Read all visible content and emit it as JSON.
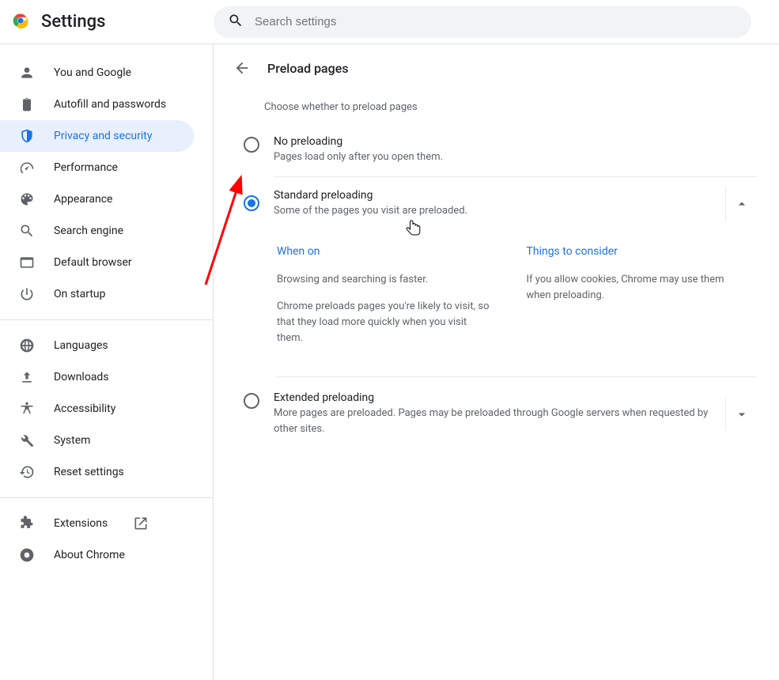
{
  "header": {
    "app_title": "Settings",
    "search_placeholder": "Search settings"
  },
  "sidebar": {
    "main": [
      {
        "id": "you-and-google",
        "label": "You and Google"
      },
      {
        "id": "autofill",
        "label": "Autofill and passwords"
      },
      {
        "id": "privacy",
        "label": "Privacy and security",
        "active": true
      },
      {
        "id": "performance",
        "label": "Performance"
      },
      {
        "id": "appearance",
        "label": "Appearance"
      },
      {
        "id": "search-engine",
        "label": "Search engine"
      },
      {
        "id": "default-browser",
        "label": "Default browser"
      },
      {
        "id": "on-startup",
        "label": "On startup"
      }
    ],
    "advanced": [
      {
        "id": "languages",
        "label": "Languages"
      },
      {
        "id": "downloads",
        "label": "Downloads"
      },
      {
        "id": "accessibility",
        "label": "Accessibility"
      },
      {
        "id": "system",
        "label": "System"
      },
      {
        "id": "reset",
        "label": "Reset settings"
      }
    ],
    "footer": [
      {
        "id": "extensions",
        "label": "Extensions",
        "external": true
      },
      {
        "id": "about",
        "label": "About Chrome"
      }
    ]
  },
  "page": {
    "title": "Preload pages",
    "subhead": "Choose whether to preload pages",
    "options": [
      {
        "id": "none",
        "title": "No preloading",
        "desc": "Pages load only after you open them.",
        "selected": false,
        "expandable": false
      },
      {
        "id": "standard",
        "title": "Standard preloading",
        "desc": "Some of the pages you visit are preloaded.",
        "selected": true,
        "expandable": true,
        "expanded": true,
        "detail": {
          "col1_title": "When on",
          "col1_p1": "Browsing and searching is faster.",
          "col1_p2": "Chrome preloads pages you're likely to visit, so that they load more quickly when you visit them.",
          "col2_title": "Things to consider",
          "col2_p1": "If you allow cookies, Chrome may use them when preloading."
        }
      },
      {
        "id": "extended",
        "title": "Extended preloading",
        "desc": "More pages are preloaded. Pages may be preloaded through Google servers when requested by other sites.",
        "selected": false,
        "expandable": true,
        "expanded": false
      }
    ]
  }
}
